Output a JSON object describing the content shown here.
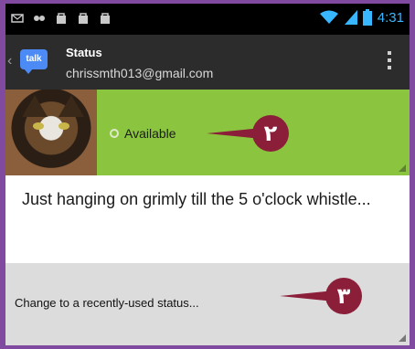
{
  "status_bar": {
    "time": "4:31",
    "notification_icons": [
      "mail-icon",
      "voicemail-icon",
      "bag-icon",
      "bag-icon",
      "bag-icon"
    ]
  },
  "action_bar": {
    "logo_text": "talk",
    "title": "Status",
    "account": "chrissmth013@gmail.com"
  },
  "presence": {
    "label": "Available",
    "color": "#8bc53f"
  },
  "status_message": {
    "text": "Just hanging on grimly till the 5 o'clock whistle..."
  },
  "recent_status": {
    "label": "Change to a recently-used status..."
  },
  "callouts": [
    {
      "label": "٢"
    },
    {
      "label": "٣"
    }
  ],
  "colors": {
    "frame": "#7f4aa0",
    "callout": "#8b1f3a",
    "time": "#38b6ff"
  }
}
